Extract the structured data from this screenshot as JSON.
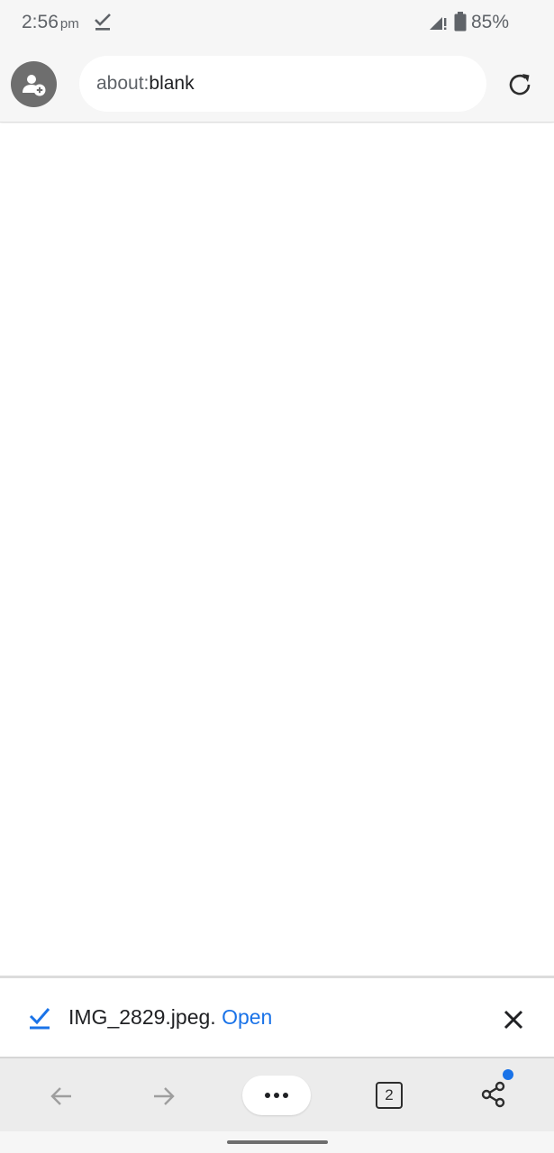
{
  "status_bar": {
    "time": "2:56",
    "ampm": "pm",
    "battery_percent": "85%",
    "icons": [
      "download-done-icon",
      "signal-icon",
      "battery-icon"
    ]
  },
  "toolbar": {
    "address_scheme": "about:",
    "address_host": "blank",
    "icons": [
      "profile-icon",
      "reload-icon"
    ]
  },
  "download_bar": {
    "filename": "IMG_2829.jpeg.",
    "open_label": "Open",
    "icons": [
      "download-check-icon",
      "close-icon"
    ]
  },
  "bottom_nav": {
    "tab_count": "2",
    "icons": [
      "back-arrow-icon",
      "forward-arrow-icon",
      "more-icon",
      "tabs-icon",
      "share-icon"
    ]
  },
  "colors": {
    "accent": "#1a73e8",
    "chrome_bg": "#f6f6f6",
    "nav_bg": "#ececec",
    "profile_bg": "#6e6e6e"
  }
}
